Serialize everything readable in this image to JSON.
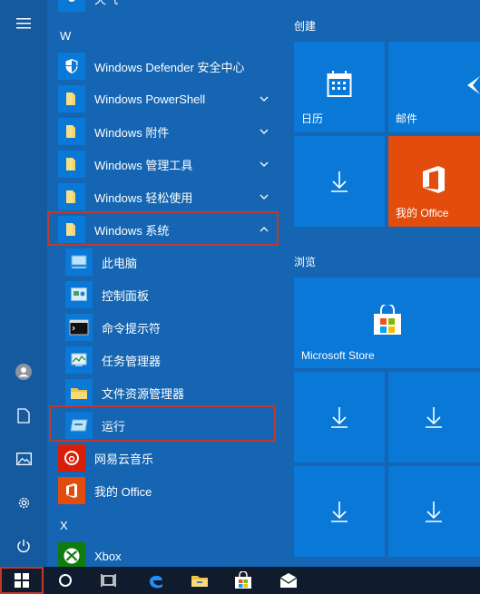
{
  "list": {
    "partial_top": "天气",
    "letter_w": "W",
    "letter_x": "X",
    "items": [
      {
        "label": "Windows Defender 安全中心",
        "icon": "shield-icon"
      },
      {
        "label": "Windows PowerShell",
        "icon": "folder-icon"
      },
      {
        "label": "Windows 附件",
        "icon": "folder-icon"
      },
      {
        "label": "Windows 管理工具",
        "icon": "folder-icon"
      },
      {
        "label": "Windows 轻松使用",
        "icon": "folder-icon"
      },
      {
        "label": "Windows 系统",
        "icon": "folder-icon"
      }
    ],
    "subitems": [
      {
        "label": "此电脑",
        "icon": "computer-icon"
      },
      {
        "label": "控制面板",
        "icon": "control-panel-icon"
      },
      {
        "label": "命令提示符",
        "icon": "terminal-icon"
      },
      {
        "label": "任务管理器",
        "icon": "task-manager-icon"
      },
      {
        "label": "文件资源管理器",
        "icon": "folder-icon"
      },
      {
        "label": "运行",
        "icon": "run-icon"
      }
    ],
    "apps": [
      {
        "label": "网易云音乐",
        "icon": "music-icon"
      },
      {
        "label": "我的 Office",
        "icon": "office-icon"
      },
      {
        "label": "Xbox",
        "icon": "xbox-icon"
      }
    ]
  },
  "tiles": {
    "group1_title": "创建",
    "group2_title": "浏览",
    "calendar_label": "日历",
    "mail_label": "邮件",
    "office_label": "我的 Office",
    "store_label": "Microsoft Store"
  },
  "colors": {
    "background": "#1565b2",
    "tile": "#0a78d7",
    "office_tile": "#e24d0e",
    "highlight": "#c0392b",
    "taskbar": "#101c2d"
  }
}
